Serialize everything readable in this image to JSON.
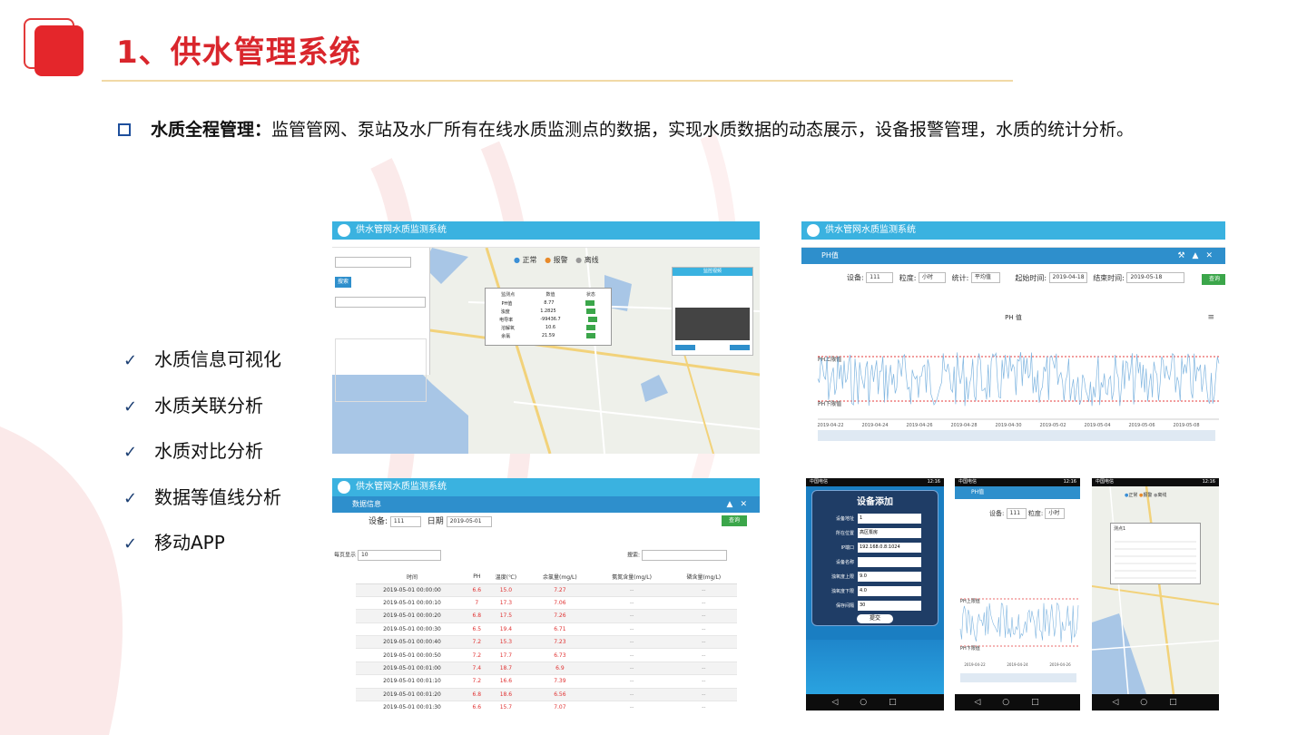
{
  "title": "1、供水管理系统",
  "description": {
    "bold": "水质全程管理：",
    "text": "监管管网、泵站及水厂所有在线水质监测点的数据，实现水质数据的动态展示，设备报警管理，水质的统计分析。"
  },
  "features": [
    "水质信息可视化",
    "水质关联分析",
    "水质对比分析",
    "数据等值线分析",
    "移动APP"
  ],
  "colors": {
    "accent": "#d9262c",
    "header": "#3ab2e0",
    "toolbar": "#2e8fcc",
    "green": "#3ba64a",
    "bullet": "#1e4f9c"
  },
  "map_shot": {
    "app_title": "供水管网水质监测系统",
    "legend": [
      "正常",
      "报警",
      "离线"
    ],
    "search_button": "搜索",
    "popup": {
      "headers": [
        "监测点",
        "数值",
        "状态"
      ],
      "rows": [
        [
          "PH值",
          "8.77"
        ],
        [
          "浊度",
          "1.2825"
        ],
        [
          "电导率",
          "-99436.7"
        ],
        [
          "溶解氧",
          "10.6"
        ],
        [
          "余氯",
          "21.59"
        ]
      ]
    },
    "video_panel": {
      "title": "监控视频"
    }
  },
  "ph_shot": {
    "app_title": "供水管网水质监测系统",
    "panel": "PH值",
    "device_label": "设备:",
    "device_value": "111",
    "granularity_label": "粒度:",
    "granularity_value": "小时",
    "stat_label": "统计:",
    "stat_value": "平均值",
    "start_label": "起始时间:",
    "start_value": "2019-04-18",
    "end_label": "结束时间:",
    "end_value": "2019-05-18",
    "query_button": "查询",
    "chart_title": "PH 值",
    "upper_label": "PH上限值",
    "lower_label": "PH下限值",
    "x_ticks": [
      "2019-04-22",
      "2019-04-24",
      "2019-04-26",
      "2019-04-28",
      "2019-04-30",
      "2019-05-02",
      "2019-05-04",
      "2019-05-06",
      "2019-05-08"
    ]
  },
  "table_shot": {
    "app_title": "供水管网水质监测系统",
    "panel": "数据信息",
    "device_label": "设备:",
    "device_value": "111",
    "date_label": "日期",
    "date_value": "2019-05-01",
    "query_button": "查询",
    "page_size_label": "每页显示",
    "page_size": "10",
    "search_label": "搜索:",
    "columns": [
      "时间",
      "PH",
      "温度(℃)",
      "余氯量(mg/L)",
      "氨氮含量(mg/L)",
      "磷含量(mg/L)"
    ],
    "rows": [
      [
        "2019-05-01 00:00:00",
        "6.6",
        "15.0",
        "7.27",
        "--",
        "--"
      ],
      [
        "2019-05-01 00:00:10",
        "7",
        "17.3",
        "7.06",
        "--",
        "--"
      ],
      [
        "2019-05-01 00:00:20",
        "6.8",
        "17.5",
        "7.26",
        "--",
        "--"
      ],
      [
        "2019-05-01 00:00:30",
        "6.5",
        "19.4",
        "6.71",
        "--",
        "--"
      ],
      [
        "2019-05-01 00:00:40",
        "7.2",
        "15.3",
        "7.23",
        "--",
        "--"
      ],
      [
        "2019-05-01 00:00:50",
        "7.2",
        "17.7",
        "6.73",
        "--",
        "--"
      ],
      [
        "2019-05-01 00:01:00",
        "7.4",
        "18.7",
        "6.9",
        "--",
        "--"
      ],
      [
        "2019-05-01 00:01:10",
        "7.2",
        "16.6",
        "7.39",
        "--",
        "--"
      ],
      [
        "2019-05-01 00:01:20",
        "6.8",
        "18.6",
        "6.56",
        "--",
        "--"
      ],
      [
        "2019-05-01 00:01:30",
        "6.6",
        "15.7",
        "7.07",
        "--",
        "--"
      ]
    ]
  },
  "phone1": {
    "status_left": "中国电信 ",
    "status_right": "12:16",
    "title": "设备添加",
    "fields": [
      {
        "label": "设备地址",
        "value": "1"
      },
      {
        "label": "所在位置",
        "value": "高区泵房"
      },
      {
        "label": "IP端口",
        "value": "192.168.0.8:1024"
      },
      {
        "label": "设备名称",
        "value": ""
      },
      {
        "label": "浊氧度上限",
        "value": "9.0"
      },
      {
        "label": "浊氧度下限",
        "value": "4.0"
      },
      {
        "label": "保存间隔",
        "value": "30"
      }
    ],
    "submit": "提交"
  },
  "phone2": {
    "status_left": "中国电信 ",
    "status_right": "12:16",
    "title": "PH值",
    "device_label": "设备:",
    "device_value": "111",
    "granularity_label": "粒度:",
    "granularity_value": "小时",
    "upper_label": "PH上限值",
    "lower_label": "PH下限值",
    "x_ticks": [
      "2019-04-22",
      "2019-04-24",
      "2019-04-26"
    ]
  },
  "phone3": {
    "status_left": "中国电信 ",
    "status_right": "12:16",
    "legend": [
      "正常",
      "报警",
      "离线"
    ],
    "popup_title": "测点1"
  }
}
